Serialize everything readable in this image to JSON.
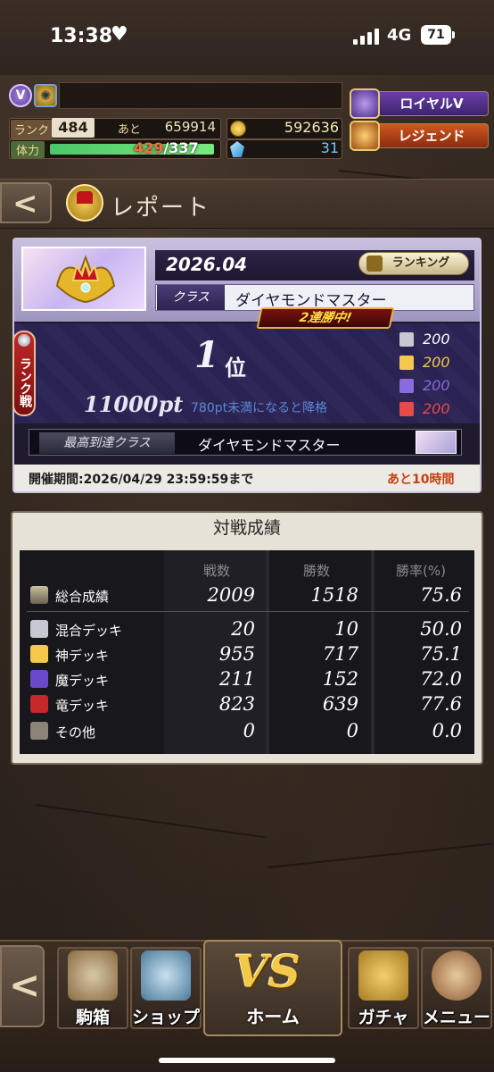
{
  "status_bar": {
    "time": "13:38",
    "network": "4G",
    "battery": "71"
  },
  "player": {
    "rank_label": "ランク",
    "rank_value": "484",
    "next_label": "あと",
    "next_value": "659914",
    "stamina_label": "体力",
    "stamina_current": "429",
    "stamina_max": "/337",
    "coins": "592636",
    "gems": "31",
    "badge_letter": "V"
  },
  "roles": {
    "royal": "ロイヤルV",
    "legend": "レジェンド"
  },
  "header": {
    "title": "レポート"
  },
  "report": {
    "month": "2026.04",
    "ranking_button": "ランキング",
    "class_label": "クラス",
    "class_value": "ダイヤモンドマスター",
    "streak": "2連勝中!",
    "rank_tab": "ランク戦",
    "place": "1",
    "place_unit": "位",
    "points": "11000pt",
    "demotion_note": "780pt未満になると降格",
    "deck_counts": [
      {
        "icon": "mixed-deck-icon",
        "value": "200",
        "color": "#ffffff"
      },
      {
        "icon": "god-deck-icon",
        "value": "200",
        "color": "#f2c94a"
      },
      {
        "icon": "demon-deck-icon",
        "value": "200",
        "color": "#8a6be0"
      },
      {
        "icon": "dragon-deck-icon",
        "value": "200",
        "color": "#e84a4a"
      }
    ],
    "best_class_label": "最高到達クラス",
    "best_class_value": "ダイヤモンドマスター",
    "period": "開催期間:2026/04/29 23:59:59まで",
    "remaining": "あと10時間"
  },
  "results": {
    "title": "対戦成績",
    "headers": [
      "戦数",
      "勝数",
      "勝率(%)"
    ],
    "rows": [
      {
        "label": "総合成績",
        "icon": "overall-icon",
        "games": "2009",
        "wins": "1518",
        "rate": "75.6"
      },
      {
        "label": "混合デッキ",
        "icon": "mixed-deck-icon",
        "games": "20",
        "wins": "10",
        "rate": "50.0"
      },
      {
        "label": "神デッキ",
        "icon": "god-deck-icon",
        "games": "955",
        "wins": "717",
        "rate": "75.1"
      },
      {
        "label": "魔デッキ",
        "icon": "demon-deck-icon",
        "games": "211",
        "wins": "152",
        "rate": "72.0"
      },
      {
        "label": "竜デッキ",
        "icon": "dragon-deck-icon",
        "games": "823",
        "wins": "639",
        "rate": "77.6"
      },
      {
        "label": "その他",
        "icon": "other-deck-icon",
        "games": "0",
        "wins": "0",
        "rate": "0.0"
      }
    ]
  },
  "nav": {
    "items": [
      "駒箱",
      "ショップ",
      "ホーム",
      "ガチャ",
      "メニュー"
    ],
    "home_logo": "VS"
  }
}
